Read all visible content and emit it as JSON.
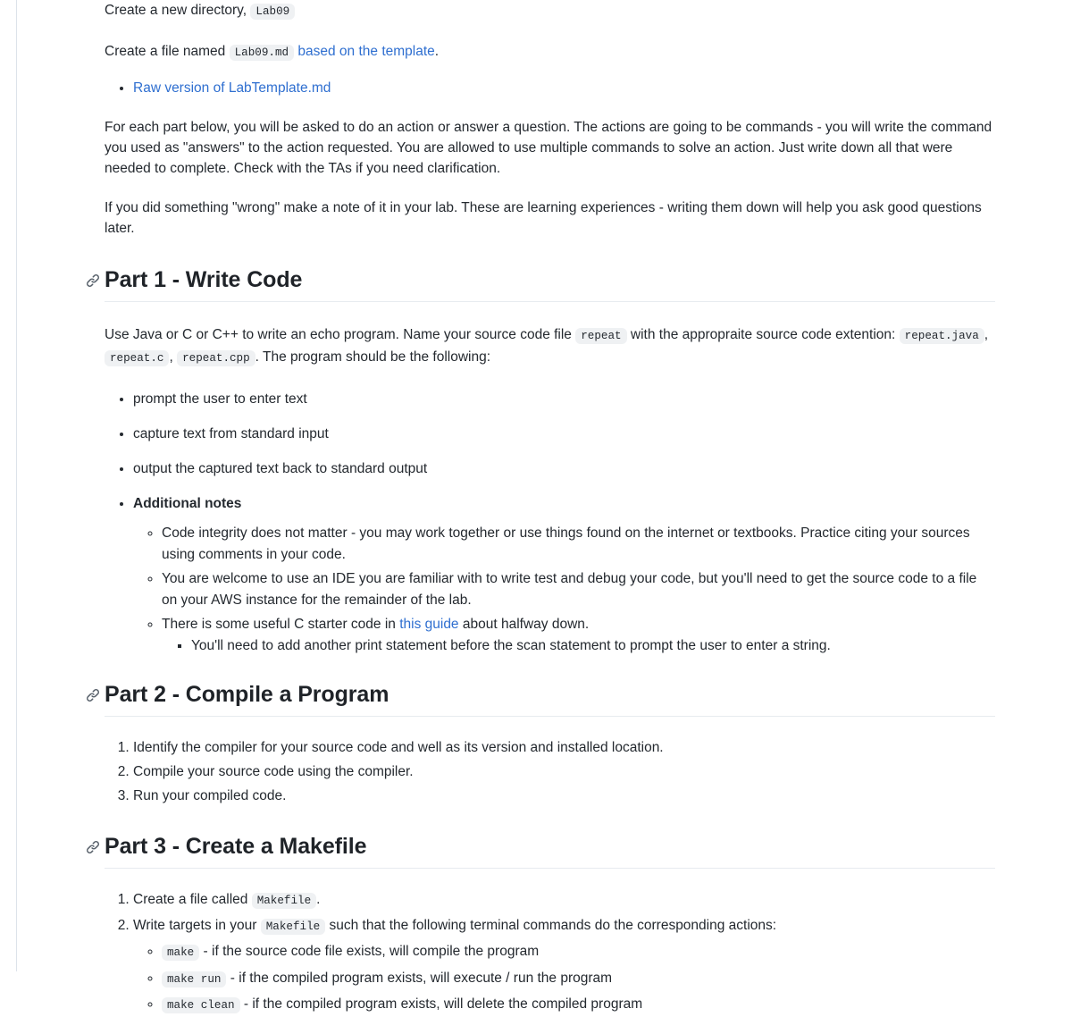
{
  "document": {
    "intro": {
      "line1_before": "Create a new directory,",
      "line1_code": "Lab09",
      "line2_before": "Create a file named",
      "line2_code": "Lab09.md",
      "line2_link": "based on the template",
      "line2_after": ".",
      "raw_link": "Raw version of LabTemplate.md",
      "paragraph1": "For each part below, you will be asked to do an action or answer a question. The actions are going to be commands - you will write the command you used as \"answers\" to the action requested. You are allowed to use multiple commands to solve an action. Just write down all that were needed to complete. Check with the TAs if you need clarification.",
      "paragraph2": "If you did something \"wrong\" make a note of it in your lab. These are learning experiences - writing them down will help you ask good questions later."
    },
    "part1": {
      "heading": "Part 1 - Write Code",
      "anchor_icon": "link-icon",
      "intro_a": "Use Java or C or C++ to write an echo program. Name your source code file",
      "code_repeat": "repeat",
      "intro_b": "with the appropraite source code extention:",
      "code_java": "repeat.java",
      "sep1": ",",
      "code_c": "repeat.c",
      "sep2": ",",
      "code_cpp": "repeat.cpp",
      "intro_c": ". The program should be the following:",
      "bullets": [
        "prompt the user to enter text",
        "capture text from standard input",
        "output the captured text back to standard output"
      ],
      "notes_label": "Additional notes",
      "notes": [
        "Code integrity does not matter - you may work together or use things found on the internet or textbooks. Practice citing your sources using comments in your code.",
        "You are welcome to use an IDE you are familiar with to write test and debug your code, but you'll need to get the source code to a file on your AWS instance for the remainder of the lab."
      ],
      "guide_note_before": "There is some useful C starter code in",
      "guide_link": "this guide",
      "guide_note_after": "about halfway down.",
      "guide_subnote": "You'll need to add another print statement before the scan statement to prompt the user to enter a string."
    },
    "part2": {
      "heading": "Part 2 - Compile a Program",
      "anchor_icon": "link-icon",
      "steps": [
        "Identify the compiler for your source code and well as its version and installed location.",
        "Compile your source code using the compiler.",
        "Run your compiled code."
      ]
    },
    "part3": {
      "heading": "Part 3 - Create a Makefile",
      "anchor_icon": "link-icon",
      "step1_before": "Create a file called",
      "step1_code": "Makefile",
      "step1_after": ".",
      "step2_before": "Write targets in your",
      "step2_code": "Makefile",
      "step2_after": "such that the following terminal commands do the corresponding actions:",
      "targets": [
        {
          "cmd": "make",
          "desc": "- if the source code file exists, will compile the program"
        },
        {
          "cmd": "make run",
          "desc": "- if the compiled program exists, will execute / run the program"
        },
        {
          "cmd": "make clean",
          "desc": "- if the compiled program exists, will delete the compiled program"
        }
      ]
    }
  },
  "theme": {
    "link_color": "#2f6fd0",
    "text_color": "#24292f",
    "code_bg": "#eff1f3",
    "rule_color": "#e7ebef",
    "left_rule_color": "#dde3ea"
  }
}
